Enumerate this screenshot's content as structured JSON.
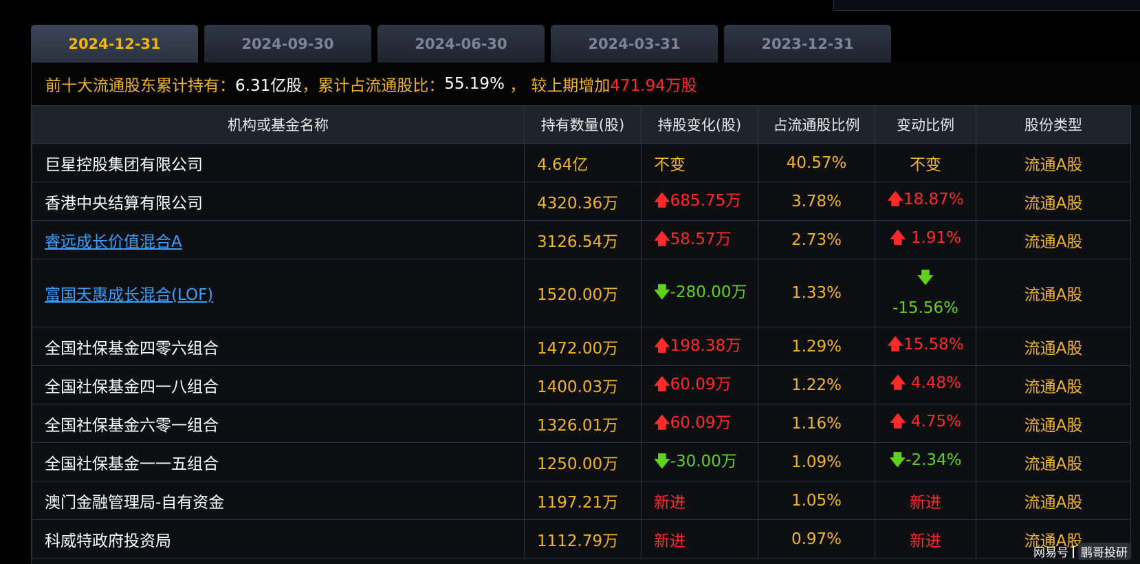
{
  "tabs": [
    {
      "label": "2024-12-31",
      "active": true
    },
    {
      "label": "2024-09-30",
      "active": false
    },
    {
      "label": "2024-06-30",
      "active": false
    },
    {
      "label": "2024-03-31",
      "active": false
    },
    {
      "label": "2023-12-31",
      "active": false
    }
  ],
  "summary": {
    "label1": "前十大流通股东累计持有：",
    "value1": "6.31亿股",
    "sep1": "，",
    "label2": "累计占流通股比：",
    "value2": "55.19%",
    "sep2": " ，",
    "label3": "较上期增加",
    "value3": "471.94万股"
  },
  "table": {
    "headers": [
      "机构或基金名称",
      "持有数量(股)",
      "持股变化(股)",
      "占流通股比例",
      "变动比例",
      "股份类型"
    ],
    "rows": [
      {
        "name": "巨星控股集团有限公司",
        "link": false,
        "qty": "4.64亿",
        "change": "不变",
        "change_dir": "none",
        "ratio": "40.57%",
        "pct": "不变",
        "pct_dir": "none",
        "type": "流通A股"
      },
      {
        "name": "香港中央结算有限公司",
        "link": false,
        "qty": "4320.36万",
        "change": "685.75万",
        "change_dir": "up",
        "ratio": "3.78%",
        "pct": "18.87%",
        "pct_dir": "up",
        "type": "流通A股"
      },
      {
        "name": "睿远成长价值混合A",
        "link": true,
        "qty": "3126.54万",
        "change": "58.57万",
        "change_dir": "up",
        "ratio": "2.73%",
        "pct": " 1.91%",
        "pct_dir": "up",
        "type": "流通A股"
      },
      {
        "name": "富国天惠成长混合(LOF)",
        "link": true,
        "qty": "1520.00万",
        "change": "-280.00万",
        "change_dir": "down",
        "ratio": "1.33%",
        "pct": " -15.56%",
        "pct_dir": "down",
        "type": "流通A股"
      },
      {
        "name": "全国社保基金四零六组合",
        "link": false,
        "qty": "1472.00万",
        "change": "198.38万",
        "change_dir": "up",
        "ratio": "1.29%",
        "pct": "15.58%",
        "pct_dir": "up",
        "type": "流通A股"
      },
      {
        "name": "全国社保基金四一八组合",
        "link": false,
        "qty": "1400.03万",
        "change": "60.09万",
        "change_dir": "up",
        "ratio": "1.22%",
        "pct": " 4.48%",
        "pct_dir": "up",
        "type": "流通A股"
      },
      {
        "name": "全国社保基金六零一组合",
        "link": false,
        "qty": "1326.01万",
        "change": "60.09万",
        "change_dir": "up",
        "ratio": "1.16%",
        "pct": " 4.75%",
        "pct_dir": "up",
        "type": "流通A股"
      },
      {
        "name": "全国社保基金一一五组合",
        "link": false,
        "qty": "1250.00万",
        "change": "-30.00万",
        "change_dir": "down",
        "ratio": "1.09%",
        "pct": "-2.34%",
        "pct_dir": "down",
        "type": "流通A股"
      },
      {
        "name": "澳门金融管理局-自有资金",
        "link": false,
        "qty": "1197.21万",
        "change": "新进",
        "change_dir": "new",
        "ratio": "1.05%",
        "pct": "新进",
        "pct_dir": "new",
        "type": "流通A股"
      },
      {
        "name": "科威特政府投资局",
        "link": false,
        "qty": "1112.79万",
        "change": "新进",
        "change_dir": "new",
        "ratio": "0.97%",
        "pct": "新进",
        "pct_dir": "new",
        "type": "流通A股"
      }
    ]
  },
  "watermark": {
    "left": "网易号",
    "right": "鹏哥投研"
  },
  "colors": {
    "accent": "#f0b429",
    "up": "#ff2a2a",
    "down": "#5fd21e",
    "link": "#3aa0ff"
  },
  "icons": {
    "up": "arrow-up-icon",
    "down": "arrow-down-icon"
  }
}
